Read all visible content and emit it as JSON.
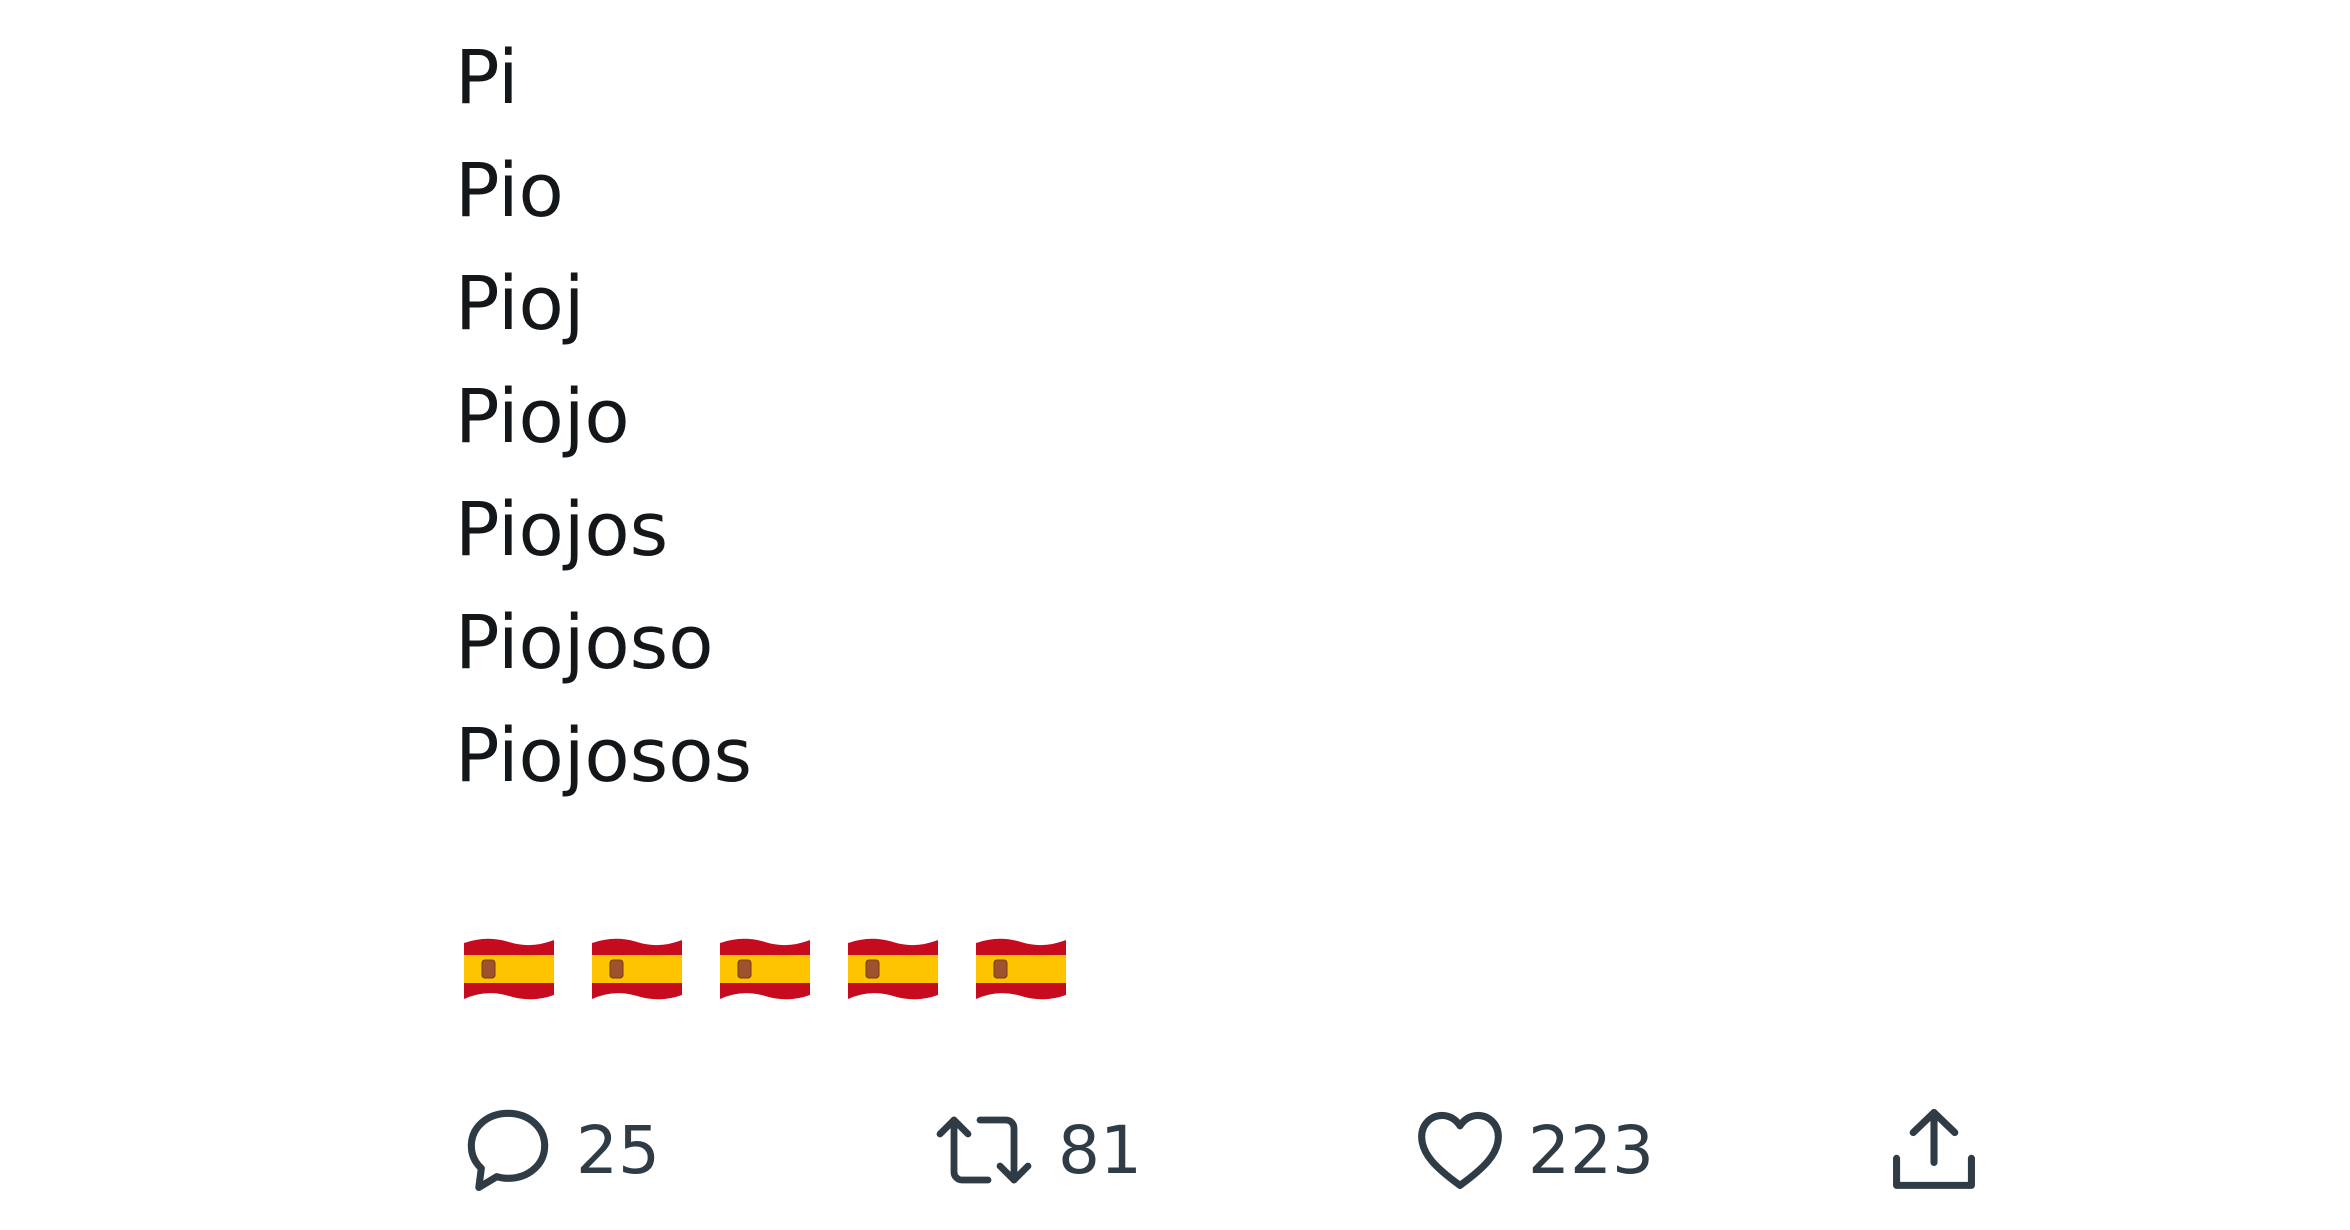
{
  "tweet": {
    "lines": [
      "Pi",
      "Pio",
      "Pioj",
      "Piojo",
      "Piojos",
      "Piojoso",
      "Piojosos"
    ],
    "flags": {
      "emoji": "spain-flag",
      "count": 5,
      "colors": {
        "red": "#c60b1e",
        "yellow": "#ffc400"
      }
    }
  },
  "actions": {
    "reply": {
      "icon": "reply-bubble-icon",
      "count": "25"
    },
    "retweet": {
      "icon": "retweet-icon",
      "count": "81"
    },
    "like": {
      "icon": "heart-icon",
      "count": "223"
    },
    "share": {
      "icon": "share-upload-icon"
    }
  },
  "colors": {
    "text": "#14171a",
    "icon": "#2f3b45",
    "background": "#ffffff"
  }
}
